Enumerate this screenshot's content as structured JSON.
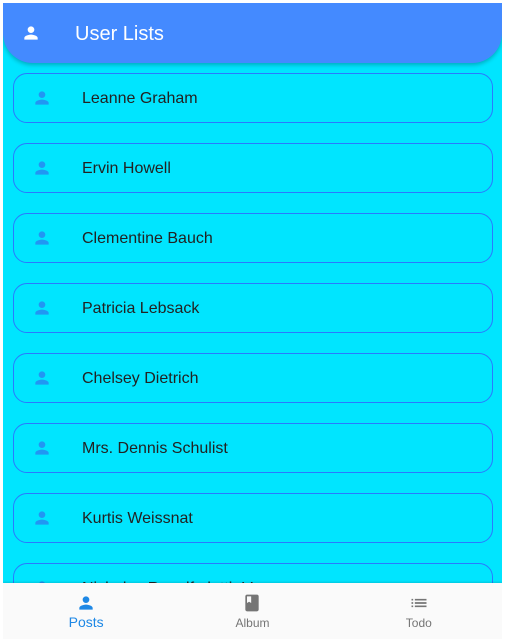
{
  "app_bar": {
    "title": "User Lists",
    "icon": "person-icon"
  },
  "users": [
    "Leanne Graham",
    "Ervin Howell",
    "Clementine Bauch",
    "Patricia Lebsack",
    "Chelsey Dietrich",
    "Mrs. Dennis Schulist",
    "Kurtis Weissnat",
    "Nicholas Runolfsdottir V"
  ],
  "bottom_nav": [
    {
      "label": "Posts",
      "icon": "person-icon",
      "active": true
    },
    {
      "label": "Album",
      "icon": "book-icon",
      "active": false
    },
    {
      "label": "Todo",
      "icon": "list-icon",
      "active": false
    }
  ],
  "colors": {
    "background": "#00e5ff",
    "app_bar": "#448aff",
    "item_border": "#2979ff",
    "item_icon": "#2196f3",
    "nav_active": "#1e88e5",
    "nav_inactive": "#757575"
  }
}
